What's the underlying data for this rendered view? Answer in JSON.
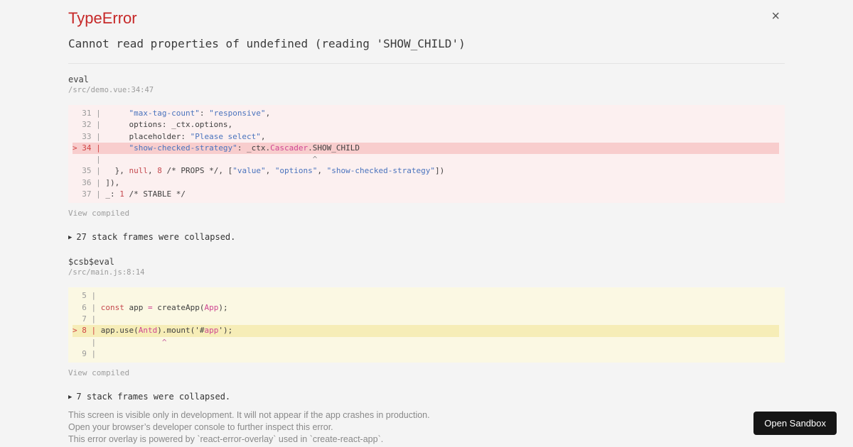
{
  "header": {
    "title": "TypeError",
    "message": "Cannot read properties of undefined (reading 'SHOW_CHILD')",
    "close": "×"
  },
  "frames": [
    {
      "fn": "eval",
      "loc": "/src/demo.vue:34:47",
      "view": "View compiled",
      "theme": "red",
      "lines": [
        {
          "num": "31",
          "hl": false,
          "t": [
            [
              "p",
              "     "
            ],
            [
              "s",
              "\"max-tag-count\""
            ],
            [
              "p",
              ": "
            ],
            [
              "s",
              "\"responsive\""
            ],
            [
              "p",
              ","
            ]
          ]
        },
        {
          "num": "32",
          "hl": false,
          "t": [
            [
              "p",
              "     options: _ctx.options,"
            ]
          ]
        },
        {
          "num": "33",
          "hl": false,
          "t": [
            [
              "p",
              "     placeholder: "
            ],
            [
              "s",
              "\"Please select\""
            ],
            [
              "p",
              ","
            ]
          ]
        },
        {
          "num": "34",
          "hl": true,
          "t": [
            [
              "p",
              "     "
            ],
            [
              "s",
              "\"show-checked-strategy\""
            ],
            [
              "p",
              ": _ctx."
            ],
            [
              "c",
              "Cascader"
            ],
            [
              "p",
              ".SHOW_CHILD"
            ]
          ]
        },
        {
          "num": "",
          "hl": false,
          "t": [
            [
              "p",
              "                                            "
            ],
            [
              "caret",
              "^"
            ]
          ]
        },
        {
          "num": "35",
          "hl": false,
          "t": [
            [
              "p",
              "  }, "
            ],
            [
              "k",
              "null"
            ],
            [
              "p",
              ", "
            ],
            [
              "n",
              "8"
            ],
            [
              "p",
              " /* PROPS */, ["
            ],
            [
              "s",
              "\"value\""
            ],
            [
              "p",
              ", "
            ],
            [
              "s",
              "\"options\""
            ],
            [
              "p",
              ", "
            ],
            [
              "s",
              "\"show-checked-strategy\""
            ],
            [
              "p",
              "])"
            ]
          ]
        },
        {
          "num": "36",
          "hl": false,
          "t": [
            [
              "p",
              "]),"
            ]
          ]
        },
        {
          "num": "37",
          "hl": false,
          "t": [
            [
              "p",
              "_: "
            ],
            [
              "n",
              "1"
            ],
            [
              "p",
              " /* STABLE */"
            ]
          ]
        }
      ]
    },
    {
      "fn": "$csb$eval",
      "loc": "/src/main.js:8:14",
      "view": "View compiled",
      "theme": "yellow",
      "lines": [
        {
          "num": "5",
          "hl": false,
          "t": []
        },
        {
          "num": "6",
          "hl": false,
          "t": [
            [
              "k",
              "const"
            ],
            [
              "p",
              " app "
            ],
            [
              "o",
              "="
            ],
            [
              "p",
              " createApp("
            ],
            [
              "c",
              "App"
            ],
            [
              "p",
              ");"
            ]
          ]
        },
        {
          "num": "7",
          "hl": false,
          "t": []
        },
        {
          "num": "8",
          "hl": true,
          "t": [
            [
              "p",
              "app.use("
            ],
            [
              "c",
              "Antd"
            ],
            [
              "p",
              ").mount("
            ],
            [
              "p",
              "'#"
            ],
            [
              "c",
              "app"
            ],
            [
              "p",
              "');"
            ]
          ]
        },
        {
          "num": "",
          "hl": false,
          "t": [
            [
              "p",
              "             "
            ],
            [
              "caret",
              "^"
            ]
          ]
        },
        {
          "num": "9",
          "hl": false,
          "t": []
        }
      ]
    }
  ],
  "collapsed": [
    {
      "arrow": "▶",
      "text": "27 stack frames were collapsed."
    },
    {
      "arrow": "▶",
      "text": "7 stack frames were collapsed."
    }
  ],
  "footer": {
    "lines": [
      "This screen is visible only in development. It will not appear if the app crashes in production.",
      "Open your browser’s developer console to further inspect this error.",
      "This error overlay is powered by `react-error-overlay` used in `create-react-app`."
    ],
    "open_sandbox": "Open Sandbox"
  },
  "colors": {
    "accent_red": "#c62828",
    "page_background": "#f4f4f4",
    "frame1_background": "#fcf0f0",
    "frame1_highlight": "#f8cdcd",
    "frame2_background": "#fbf8e3",
    "frame2_highlight": "#f6edb7",
    "string_token": "#4a73bd",
    "keyword_token": "#c5484e",
    "class_token": "#cf4692",
    "button_background": "#161616"
  }
}
